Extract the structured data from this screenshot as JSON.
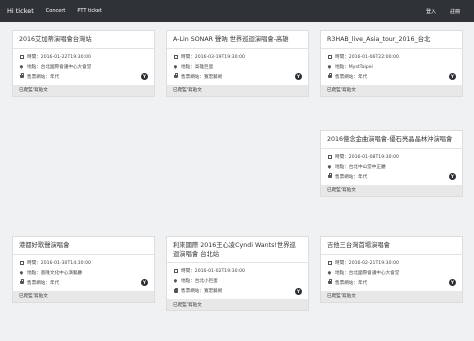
{
  "nav": {
    "brand": "Hi ticket",
    "links": [
      "Concert",
      "PTT ticket"
    ],
    "login": "登入",
    "register": "註冊"
  },
  "cards": [
    {
      "title": "2016艾加蒂演唱會台灣站",
      "time": "時間：2016-01-22T19:30:00",
      "place": "地點：台北國際會議中心大會堂",
      "sale": "售票網站：年代",
      "badge": "Y",
      "footer": "已爬監'寫貼文"
    },
    {
      "title": "A-Lin SONAR 聲吶 世界巡迴演唱會-高雄",
      "time": "時間：2016-03-19T19:30:00",
      "place": "地點：高雄巨蛋",
      "sale": "售票網站：寬宏藝術",
      "badge": "Y",
      "footer": "已爬監'寫貼文"
    },
    {
      "title": "R3HAB_live_Asia_tour_2016_台北",
      "time": "時間：2016-01-06T22:00:00",
      "place": "地點：MystTaipei",
      "sale": "售票網站：年代",
      "badge": "Y",
      "footer": "已爬監'寫貼文"
    },
    {
      "title": "2016億念金曲演唱會-優石亮晶晶林沖演唱會",
      "time": "時間：2016-01-08T19:30:00",
      "place": "地點：台北中山堂中正廳",
      "sale": "售票網站：年代",
      "badge": "Y",
      "footer": "已爬監'寫貼文"
    },
    {
      "title": "港都好歌聲演唱會",
      "time": "時間：2016-01-30T14:30:00",
      "place": "地點：基隆文化中心演藝廳",
      "sale": "售票網站：年代",
      "badge": "Y",
      "footer": "已爬監'寫貼文"
    },
    {
      "title": "利來國際 2016王心凌Cyndi Wants!世界巡迴演唱會 台北站",
      "time": "時間：2016-01-02T19:30:00",
      "place": "地點：台北小巨蛋",
      "sale": "售票網站：寬宏藝術",
      "badge": "Y",
      "footer": "已爬監'寫貼文"
    },
    {
      "title": "吉他三台灣首場演唱會",
      "time": "時間：2016-02-21T19:30:00",
      "place": "地點：台北國際會議中心大會堂",
      "sale": "售票網站：年代",
      "badge": "Y",
      "footer": "已爬監'寫貼文"
    }
  ]
}
